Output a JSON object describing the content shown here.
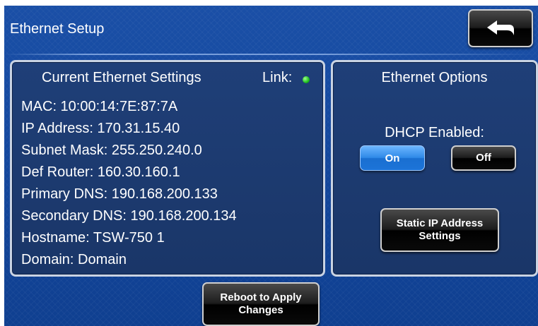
{
  "header": {
    "title": "Ethernet Setup",
    "back_icon": "back-arrow-icon"
  },
  "current_settings": {
    "heading": "Current Ethernet Settings",
    "link_label": "Link:",
    "link_status_color": "#1fbf1f",
    "lines": [
      "MAC: 10:00:14:7E:87:7A",
      "IP Address: 170.31.15.40",
      "Subnet Mask: 255.250.240.0",
      "Def Router: 160.30.160.1",
      "Primary DNS: 190.168.200.133",
      "Secondary DNS: 190.168.200.134",
      "Hostname: TSW-750 1",
      "Domain: Domain"
    ]
  },
  "ethernet_options": {
    "heading": "Ethernet Options",
    "dhcp_label": "DHCP Enabled:",
    "on_label": "On",
    "off_label": "Off",
    "dhcp_selected": "On",
    "static_ip_label": "Static IP Address Settings"
  },
  "footer": {
    "reboot_label": "Reboot to Apply Changes"
  },
  "colors": {
    "background": "#1549a0",
    "accent_selected": "#2f8ae8",
    "button_dark": "#000000"
  }
}
